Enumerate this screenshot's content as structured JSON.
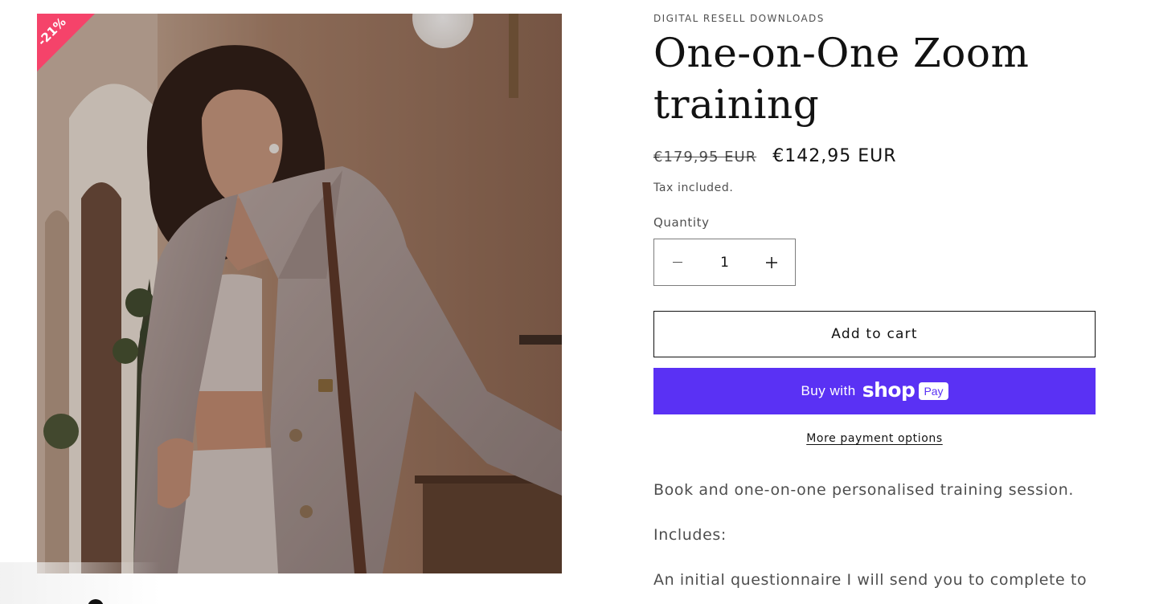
{
  "product": {
    "vendor": "DIGITAL RESELL DOWNLOADS",
    "title": "One-on-One Zoom training",
    "sale_badge": "-21%",
    "price_compare": "€179,95 EUR",
    "price_sale": "€142,95 EUR",
    "tax_note": "Tax included."
  },
  "quantity": {
    "label": "Quantity",
    "value": "1",
    "decrease_icon": "minus-icon",
    "increase_icon": "plus-icon"
  },
  "buttons": {
    "add_to_cart": "Add to cart",
    "buy_with": "Buy with",
    "shop_word": "shop",
    "pay_chip": "Pay",
    "more_payment_options": "More payment options"
  },
  "description": {
    "line1": "Book and one-on-one personalised training session.",
    "line2": "Includes:",
    "line3": "An initial questionnaire I will send you to complete to"
  },
  "colors": {
    "sale_badge": "#f5436a",
    "shop_pay": "#5a31f4",
    "text": "#121212"
  }
}
